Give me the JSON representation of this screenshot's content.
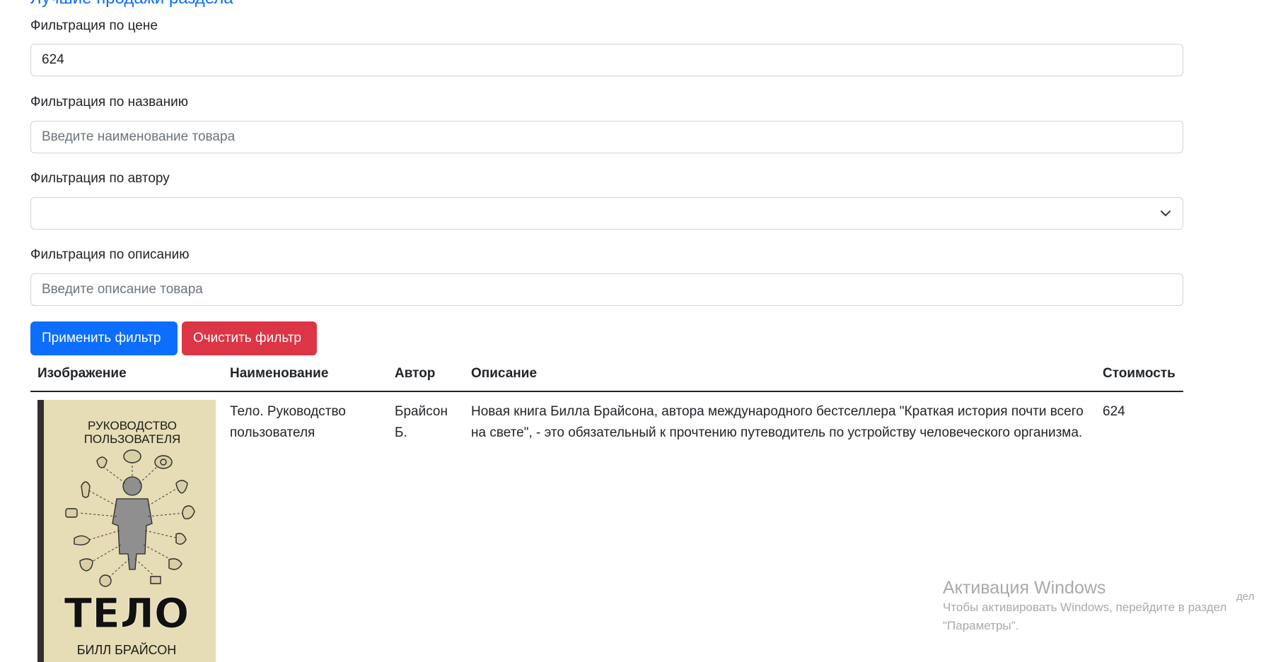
{
  "section": {
    "title": "Лучшие продажи раздела"
  },
  "filters": {
    "price": {
      "label": "Фильтрация по цене",
      "value": "624"
    },
    "name": {
      "label": "Фильтрация по названию",
      "placeholder": "Введите наименование товара"
    },
    "author": {
      "label": "Фильтрация по автору",
      "selected": ""
    },
    "description": {
      "label": "Фильтрация по описанию",
      "placeholder": "Введите описание товара"
    }
  },
  "buttons": {
    "apply": "Применить фильтр",
    "clear": "Очистить фильтр"
  },
  "table": {
    "headers": [
      "Изображение",
      "Наименование",
      "Автор",
      "Описание",
      "Стоимость"
    ],
    "rows": [
      {
        "title": "Тело. Руководство пользователя",
        "author": "Брайсон Б.",
        "description": "Новая книга Билла Брайсона, автора международного бестселлера \"Краткая история почти всего на свете\", - это обязательный к прочтению путеводитель по устройству человеческого организма.",
        "price": "624",
        "cover": {
          "line1": "РУКОВОДСТВО",
          "line2": "ПОЛЬЗОВАТЕЛЯ",
          "title": "ТЕЛО",
          "author": "БИЛЛ БРАЙСОН"
        }
      }
    ]
  },
  "watermark": {
    "title": "Активация Windows",
    "text": "Чтобы активировать Windows, перейдите в раздел \"Параметры\".",
    "fragment": "дел"
  }
}
